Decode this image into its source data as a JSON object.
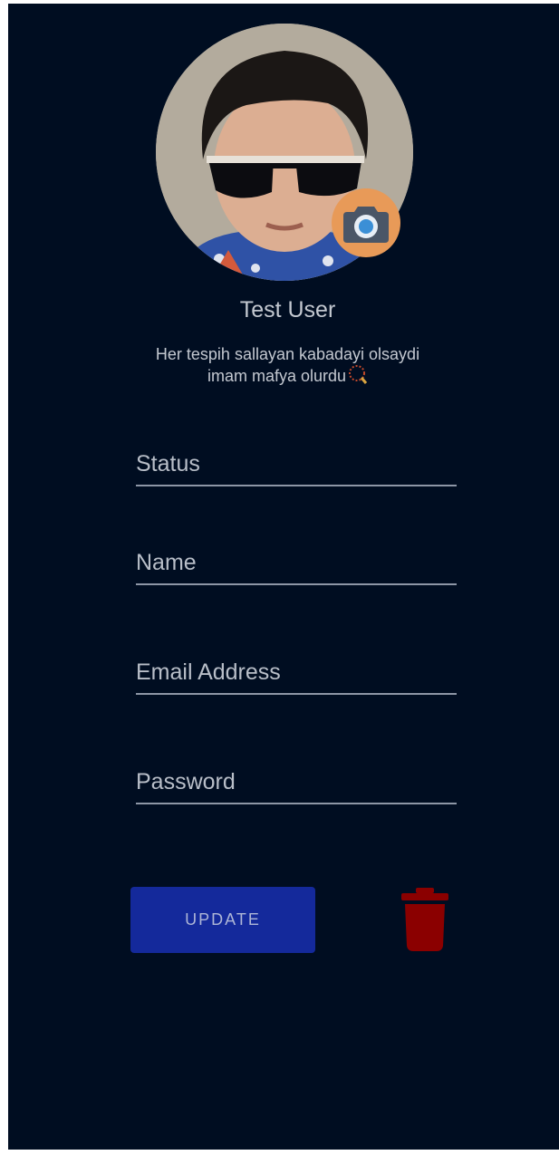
{
  "profile": {
    "name": "Test User",
    "bio_line1": "Her tespih sallayan kabadayi olsaydi",
    "bio_line2": "imam mafya olurdu",
    "bio_icon": "prayer-beads-icon",
    "avatar_icon": "profile-photo",
    "camera_icon": "camera-icon"
  },
  "form": {
    "status": {
      "placeholder": "Status",
      "value": ""
    },
    "name": {
      "placeholder": "Name",
      "value": ""
    },
    "email": {
      "placeholder": "Email Address",
      "value": ""
    },
    "password": {
      "placeholder": "Password",
      "value": ""
    }
  },
  "actions": {
    "update_label": "UPDATE",
    "delete_icon": "trash-icon"
  },
  "colors": {
    "background": "#000d21",
    "camera_badge": "#e89a58",
    "update_button": "#14299b",
    "delete_icon": "#8b0000",
    "text": "#c3c8d0",
    "underline": "#8d96a6"
  }
}
